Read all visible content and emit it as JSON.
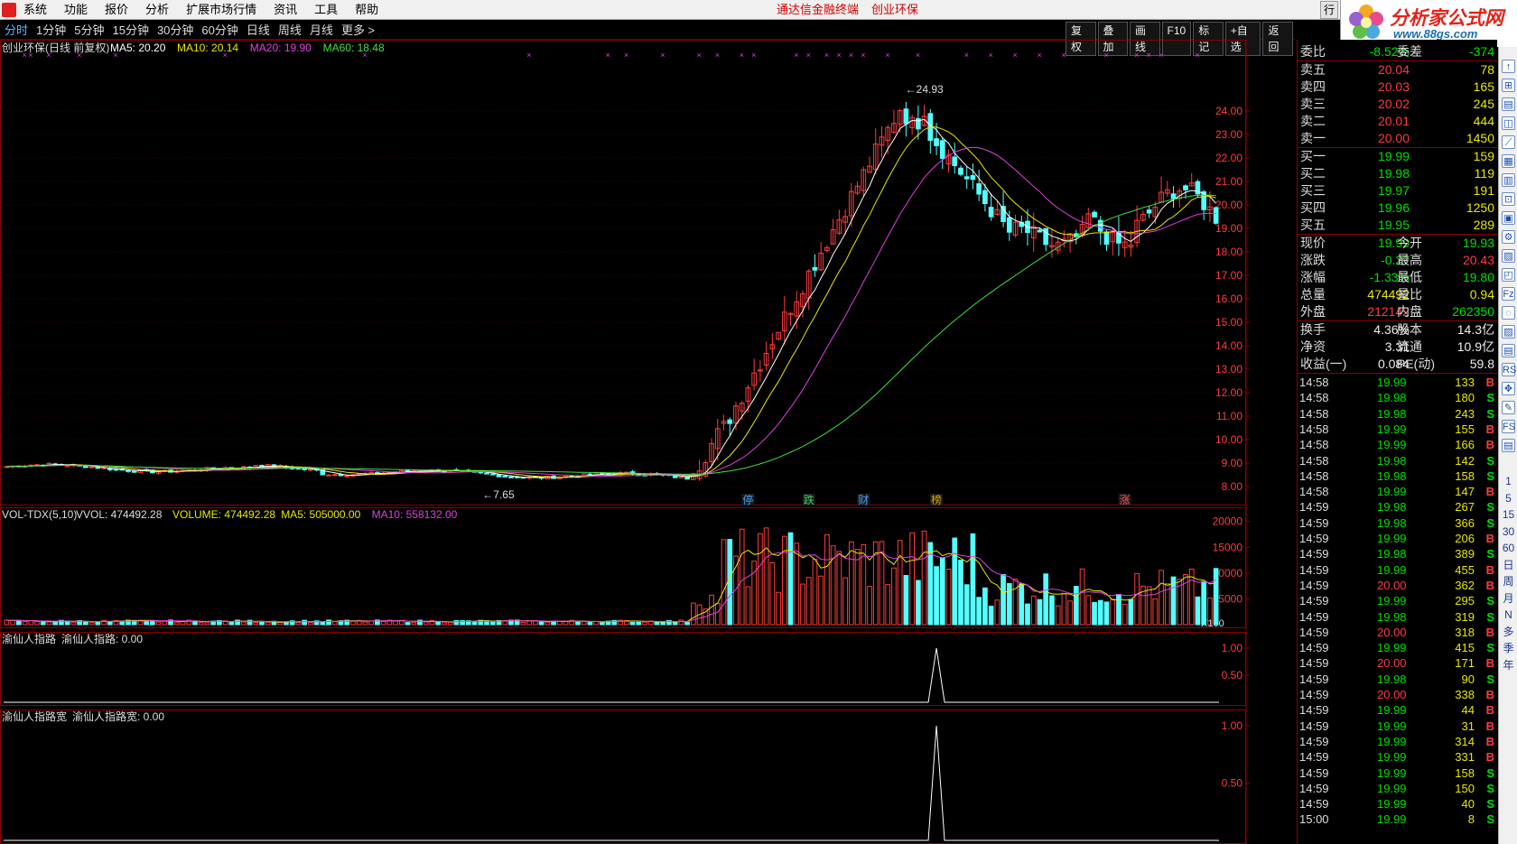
{
  "menu": {
    "items": [
      "系统",
      "功能",
      "报价",
      "分析",
      "扩展市场行情",
      "资讯",
      "工具",
      "帮助"
    ],
    "center_links": [
      "通达信金融终端",
      "创业环保"
    ],
    "window_button": "行",
    "brand_title": "分析家公式网",
    "brand_url": "www.88gs.com"
  },
  "toolbar": {
    "periods": [
      "分时",
      "1分钟",
      "5分钟",
      "15分钟",
      "30分钟",
      "60分钟",
      "日线",
      "周线",
      "月线",
      "更多 >"
    ],
    "active_period": "分时",
    "buttons": [
      "复权",
      "叠加",
      "画线",
      "F10",
      "标记",
      "+自选",
      "返回"
    ]
  },
  "price_panel": {
    "title": "创业环保(日线 前复权)",
    "ma_labels": [
      {
        "text": "MA5: 20.20",
        "color": "#ffffff"
      },
      {
        "text": "MA10: 20.14",
        "color": "#e8e800"
      },
      {
        "text": "MA20: 19.90",
        "color": "#e040e0"
      },
      {
        "text": "MA60: 18.48",
        "color": "#40e040"
      }
    ],
    "y_ticks": [
      "24.00",
      "23.00",
      "22.00",
      "21.00",
      "20.00",
      "19.00",
      "18.00",
      "17.00",
      "16.00",
      "15.00",
      "14.00",
      "13.00",
      "12.00",
      "11.00",
      "10.00",
      "9.00",
      "8.00"
    ],
    "high_label": "24.93",
    "low_label": "7.65",
    "event_tags": [
      {
        "text": "停",
        "color": "#3fa0ff"
      },
      {
        "text": "跌",
        "color": "#3fd060"
      },
      {
        "text": "财",
        "color": "#3fa0ff"
      },
      {
        "text": "榜",
        "color": "#e0a000"
      },
      {
        "text": "涨",
        "color": "#ff5050"
      }
    ]
  },
  "volume_panel": {
    "title": "VOL-TDX(5,10)",
    "labels": [
      {
        "text": "VVOL: 474492.28",
        "color": "#dddddd"
      },
      {
        "text": "VOLUME: 474492.28",
        "color": "#e8e800"
      },
      {
        "text": "MA5: 505000.00",
        "color": "#e8e800"
      },
      {
        "text": "MA10: 558132.00",
        "color": "#e040e0"
      }
    ],
    "y_ticks": [
      "20000",
      "15000",
      "10000",
      "5000"
    ],
    "unit": "X100"
  },
  "indicator1": {
    "title": "渝仙人指路",
    "label": "渝仙人指路: 0.00",
    "y_ticks": [
      "1.00",
      "0.50"
    ]
  },
  "indicator2": {
    "title": "渝仙人指路宽",
    "label": "渝仙人指路宽: 0.00",
    "y_ticks": [
      "1.00",
      "0.50"
    ]
  },
  "quote": {
    "header_icon": "L",
    "wei": {
      "label": "委比",
      "value": "-8.52%",
      "label2": "委差",
      "value2": "-374"
    },
    "asks": [
      {
        "label": "卖五",
        "price": "20.04",
        "amount": "78"
      },
      {
        "label": "卖四",
        "price": "20.03",
        "amount": "165"
      },
      {
        "label": "卖三",
        "price": "20.02",
        "amount": "245"
      },
      {
        "label": "卖二",
        "price": "20.01",
        "amount": "444"
      },
      {
        "label": "卖一",
        "price": "20.00",
        "amount": "1450"
      }
    ],
    "bids": [
      {
        "label": "买一",
        "price": "19.99",
        "amount": "159"
      },
      {
        "label": "买二",
        "price": "19.98",
        "amount": "119"
      },
      {
        "label": "买三",
        "price": "19.97",
        "amount": "191"
      },
      {
        "label": "买四",
        "price": "19.96",
        "amount": "1250"
      },
      {
        "label": "买五",
        "price": "19.95",
        "amount": "289"
      }
    ],
    "stats": [
      {
        "l1": "现价",
        "v1": "19.99",
        "c1": "green",
        "l2": "今开",
        "v2": "19.93",
        "c2": "green"
      },
      {
        "l1": "涨跌",
        "v1": "-0.27",
        "c1": "green",
        "l2": "最高",
        "v2": "20.43",
        "c2": "red"
      },
      {
        "l1": "涨幅",
        "v1": "-1.33%",
        "c1": "green",
        "l2": "最低",
        "v2": "19.80",
        "c2": "green"
      },
      {
        "l1": "总量",
        "v1": "474492",
        "c1": "yellow",
        "l2": "量比",
        "v2": "0.94",
        "c2": "yellow"
      },
      {
        "l1": "外盘",
        "v1": "212142",
        "c1": "red",
        "l2": "内盘",
        "v2": "262350",
        "c2": "green"
      }
    ],
    "fundamentals": [
      {
        "l1": "换手",
        "v1": "4.36%",
        "l2": "股本",
        "v2": "14.3亿"
      },
      {
        "l1": "净资",
        "v1": "3.31",
        "l2": "流通",
        "v2": "10.9亿"
      },
      {
        "l1": "收益(一)",
        "v1": "0.084",
        "l2": "PE(动)",
        "v2": "59.8"
      }
    ],
    "ticks": [
      {
        "time": "14:58",
        "price": "19.99",
        "vol": "133",
        "side": "B"
      },
      {
        "time": "14:58",
        "price": "19.98",
        "vol": "180",
        "side": "S"
      },
      {
        "time": "14:58",
        "price": "19.98",
        "vol": "243",
        "side": "S"
      },
      {
        "time": "14:58",
        "price": "19.99",
        "vol": "155",
        "side": "B"
      },
      {
        "time": "14:58",
        "price": "19.99",
        "vol": "166",
        "side": "B"
      },
      {
        "time": "14:58",
        "price": "19.98",
        "vol": "142",
        "side": "S"
      },
      {
        "time": "14:58",
        "price": "19.98",
        "vol": "158",
        "side": "S"
      },
      {
        "time": "14:58",
        "price": "19.99",
        "vol": "147",
        "side": "B"
      },
      {
        "time": "14:59",
        "price": "19.98",
        "vol": "267",
        "side": "S"
      },
      {
        "time": "14:59",
        "price": "19.98",
        "vol": "366",
        "side": "S"
      },
      {
        "time": "14:59",
        "price": "19.99",
        "vol": "206",
        "side": "B"
      },
      {
        "time": "14:59",
        "price": "19.98",
        "vol": "389",
        "side": "S"
      },
      {
        "time": "14:59",
        "price": "19.99",
        "vol": "455",
        "side": "B"
      },
      {
        "time": "14:59",
        "price": "20.00",
        "vol": "362",
        "side": "B"
      },
      {
        "time": "14:59",
        "price": "19.99",
        "vol": "295",
        "side": "S"
      },
      {
        "time": "14:59",
        "price": "19.98",
        "vol": "319",
        "side": "S"
      },
      {
        "time": "14:59",
        "price": "20.00",
        "vol": "318",
        "side": "B"
      },
      {
        "time": "14:59",
        "price": "19.99",
        "vol": "415",
        "side": "S"
      },
      {
        "time": "14:59",
        "price": "20.00",
        "vol": "171",
        "side": "B"
      },
      {
        "time": "14:59",
        "price": "19.98",
        "vol": "90",
        "side": "S"
      },
      {
        "time": "14:59",
        "price": "20.00",
        "vol": "338",
        "side": "B"
      },
      {
        "time": "14:59",
        "price": "19.99",
        "vol": "44",
        "side": "B"
      },
      {
        "time": "14:59",
        "price": "19.99",
        "vol": "31",
        "side": "B"
      },
      {
        "time": "14:59",
        "price": "19.99",
        "vol": "314",
        "side": "B"
      },
      {
        "time": "14:59",
        "price": "19.99",
        "vol": "331",
        "side": "B"
      },
      {
        "time": "14:59",
        "price": "19.99",
        "vol": "158",
        "side": "S"
      },
      {
        "time": "14:59",
        "price": "19.99",
        "vol": "150",
        "side": "S"
      },
      {
        "time": "14:59",
        "price": "19.99",
        "vol": "40",
        "side": "S"
      },
      {
        "time": "15:00",
        "price": "19.99",
        "vol": "8",
        "side": "S"
      }
    ]
  },
  "side_strip": {
    "labels": [
      "1",
      "5",
      "15",
      "30",
      "60",
      "日",
      "周",
      "月",
      "N",
      "多",
      "季",
      "年"
    ]
  },
  "colors": {
    "up": "#ff3c3c",
    "down": "#54ffff",
    "frame": "#8b0000"
  },
  "chart_data": {
    "type": "candlestick",
    "price_range": [
      7.5,
      25.5
    ],
    "volume_range": [
      0,
      21000
    ],
    "ohlc_segments": [
      {
        "range": "early flat period",
        "price_level": 8.8,
        "low": 7.65
      },
      {
        "range": "rally",
        "from": 8.5,
        "peak": 24.93
      },
      {
        "range": "pullback and consolidation",
        "end": 19.99
      }
    ]
  }
}
